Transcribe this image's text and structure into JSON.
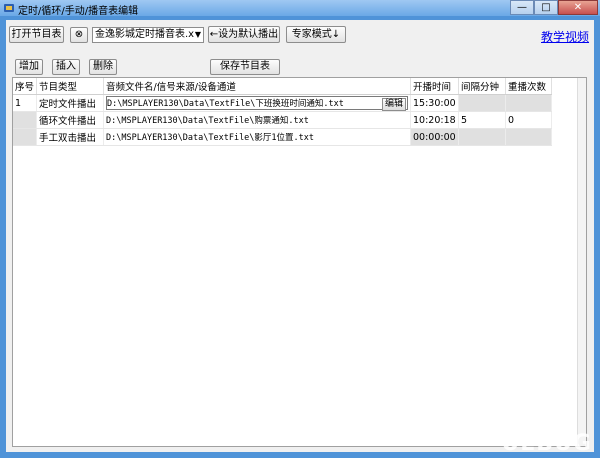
{
  "window": {
    "title": "定时/循环/手动/播音表编辑",
    "min_label": "—",
    "max_label": "□",
    "close_label": "✕"
  },
  "toolbar": {
    "open_label": "打开节目表",
    "clear_icon_label": "⊗",
    "combo_value": "金逸影城定时播音表.x",
    "set_default_label": "←设为默认播出",
    "expert_label": "专家模式↓",
    "tutorial_link": "教学视频"
  },
  "actions": {
    "add_label": "增加",
    "insert_label": "插入",
    "delete_label": "删除",
    "save_label": "保存节目表"
  },
  "table": {
    "headers": [
      "序号",
      "节目类型",
      "音频文件名/信号来源/设备通道",
      "开播时间",
      "间隔分钟",
      "重播次数"
    ],
    "edit_label": "编辑",
    "rows": [
      {
        "index": "1",
        "type": "定时文件播出",
        "file": "D:\\MSPLAYER130\\Data\\TextFile\\下班换班时间通知.txt",
        "start": "15:30:00",
        "interval": "",
        "repeat": ""
      },
      {
        "index": "",
        "type": "循环文件播出",
        "file": "D:\\MSPLAYER130\\Data\\TextFile\\购票通知.txt",
        "start": "10:20:18",
        "interval": "5",
        "repeat": "0"
      },
      {
        "index": "",
        "type": "手工双击播出",
        "file": "D:\\MSPLAYER130\\Data\\TextFile\\影厅1位置.txt",
        "start": "00:00:00",
        "interval": "",
        "repeat": ""
      }
    ]
  },
  "watermark": "UEBUG"
}
